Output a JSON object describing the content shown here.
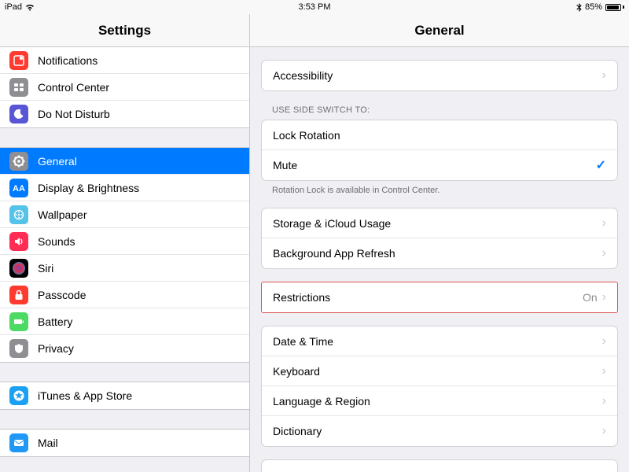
{
  "statusbar": {
    "device": "iPad",
    "time": "3:53 PM",
    "battery_pct": "85%"
  },
  "nav": {
    "left_title": "Settings",
    "right_title": "General"
  },
  "sidebar": {
    "groups": [
      {
        "items": [
          {
            "name": "notifications",
            "label": "Notifications",
            "icon": "notifications",
            "bg": "#ff3b30"
          },
          {
            "name": "control-center",
            "label": "Control Center",
            "icon": "control-center",
            "bg": "#8e8e93"
          },
          {
            "name": "do-not-disturb",
            "label": "Do Not Disturb",
            "icon": "moon",
            "bg": "#5856d6"
          }
        ]
      },
      {
        "items": [
          {
            "name": "general",
            "label": "General",
            "icon": "gear",
            "bg": "#8e8e93",
            "selected": true
          },
          {
            "name": "display-brightness",
            "label": "Display & Brightness",
            "icon": "display",
            "bg": "#007aff"
          },
          {
            "name": "wallpaper",
            "label": "Wallpaper",
            "icon": "wallpaper",
            "bg": "#55c2e8"
          },
          {
            "name": "sounds",
            "label": "Sounds",
            "icon": "sounds",
            "bg": "#ff2d55"
          },
          {
            "name": "siri",
            "label": "Siri",
            "icon": "siri",
            "bg": "#000000"
          },
          {
            "name": "passcode",
            "label": "Passcode",
            "icon": "passcode",
            "bg": "#ff3b30"
          },
          {
            "name": "battery",
            "label": "Battery",
            "icon": "battery",
            "bg": "#4cd964"
          },
          {
            "name": "privacy",
            "label": "Privacy",
            "icon": "privacy",
            "bg": "#8e8e93"
          }
        ]
      },
      {
        "items": [
          {
            "name": "itunes-app-store",
            "label": "iTunes & App Store",
            "icon": "appstore",
            "bg": "#1ba1f3"
          }
        ]
      },
      {
        "items": [
          {
            "name": "mail",
            "label": "Mail",
            "icon": "mail",
            "bg": "#1f98f6"
          }
        ]
      }
    ]
  },
  "detail": {
    "accessibility": {
      "label": "Accessibility"
    },
    "side_switch_header": "USE SIDE SWITCH TO:",
    "side_switch": {
      "lock_rotation": "Lock Rotation",
      "mute": "Mute"
    },
    "side_switch_footer": "Rotation Lock is available in Control Center.",
    "storage": {
      "storage_icloud": "Storage & iCloud Usage",
      "bg_refresh": "Background App Refresh"
    },
    "restrictions": {
      "label": "Restrictions",
      "value": "On"
    },
    "locale": {
      "date_time": "Date & Time",
      "keyboard": "Keyboard",
      "language_region": "Language & Region",
      "dictionary": "Dictionary"
    }
  }
}
